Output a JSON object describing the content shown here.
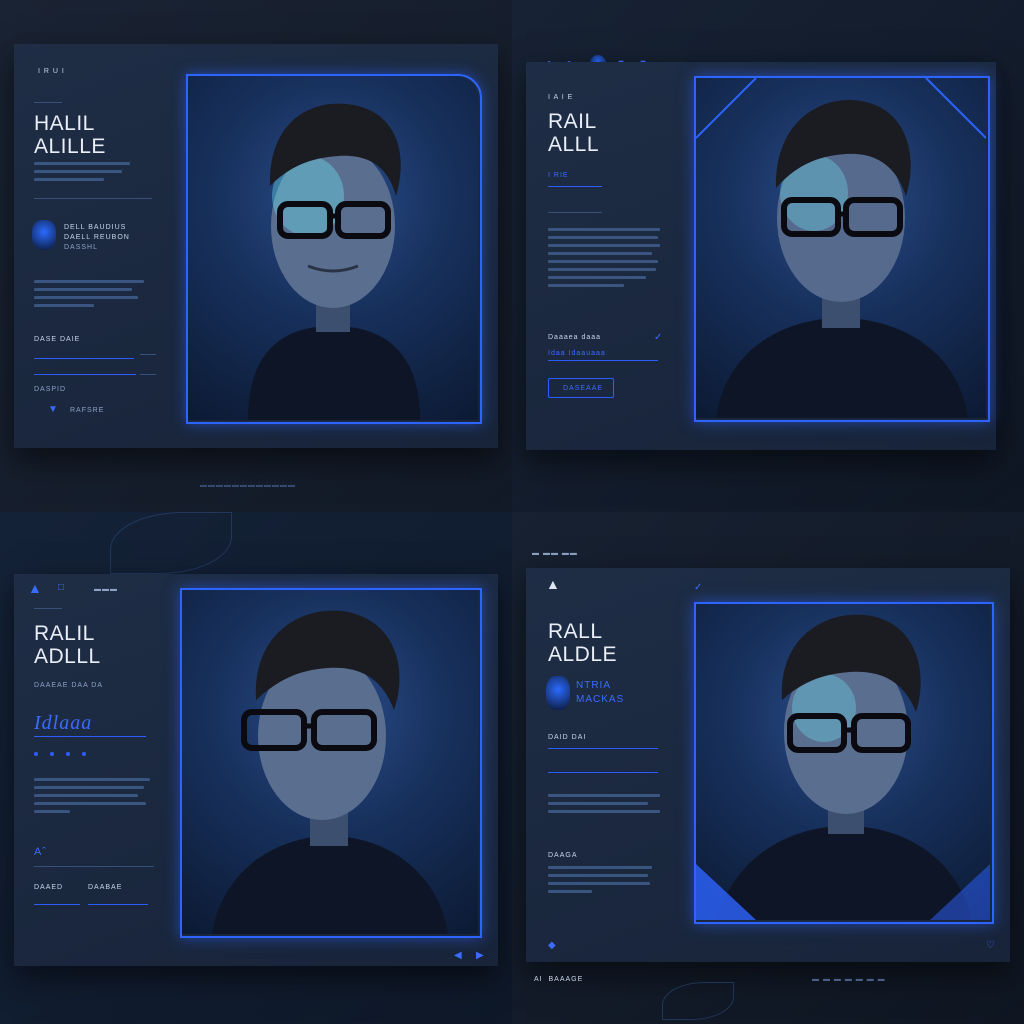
{
  "panels": [
    {
      "brand": "I R U I",
      "title_line1": "HALIL",
      "title_line2": "ALILLE",
      "author_name": "DELL BAUDIUS",
      "author_role": "DAELL REUBON",
      "author_sub": "DASSHL",
      "field_label": "DASE DAIE",
      "footer_label": "DASPID",
      "icon_label": "RAFSRE"
    },
    {
      "brand": "I A I E",
      "title_line1": "RAIL",
      "title_line2": "ALLL",
      "tag": "I RIE",
      "field_label": "Daaaea daaa",
      "field_value": "Idaa Idaauaaa",
      "button_label": "DASEAAE"
    },
    {
      "title_line1": "RALIL",
      "title_line2": "ADLLL",
      "meta": "DAAEAE  DAA DA",
      "script": "Idlaaa",
      "label_a": "Aˆ",
      "footer_a": "DAAED",
      "footer_b": "DAABAE"
    },
    {
      "title_line1": "RALL",
      "title_line2": "ALDLE",
      "author_name": "NTRIA",
      "author_role": "MACKAS",
      "field_label": "DAID DAI",
      "section_label": "DAAGA",
      "footer": "AI  BAAAGE"
    }
  ],
  "colors": {
    "accent": "#2d64ff",
    "card": "#1e2d45",
    "background": "#0d1420"
  }
}
